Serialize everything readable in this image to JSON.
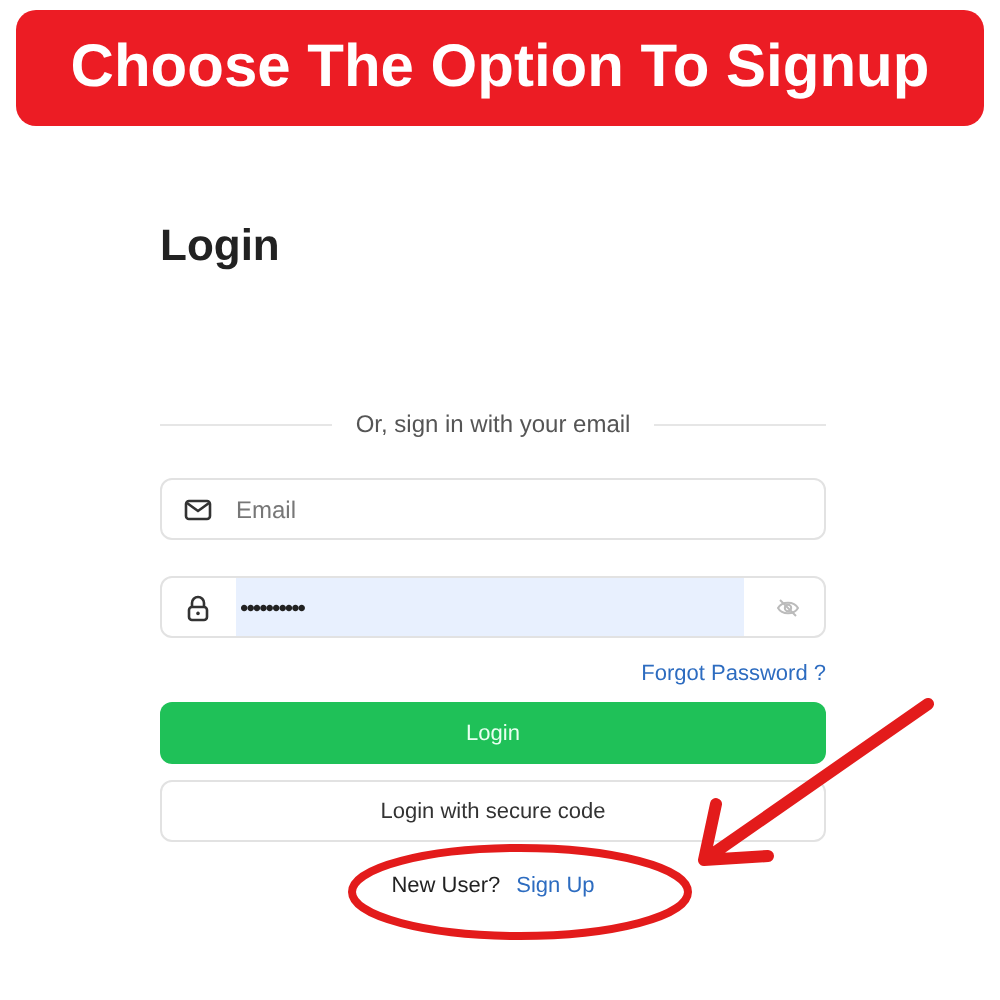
{
  "banner": {
    "text": "Choose The Option To Signup"
  },
  "login": {
    "title": "Login",
    "divider_text": "Or, sign in with your email",
    "email_field": {
      "placeholder": "Email"
    },
    "password_field": {
      "value": "••••••••••",
      "autofilled": true
    },
    "forgot_password_link": "Forgot Password ?",
    "buttons": [
      {
        "label": "Login",
        "kind": "primary"
      },
      {
        "label": "Login with secure code",
        "kind": "secondary"
      }
    ],
    "signup_prompt": "New User?",
    "signup_link": "Sign Up"
  }
}
